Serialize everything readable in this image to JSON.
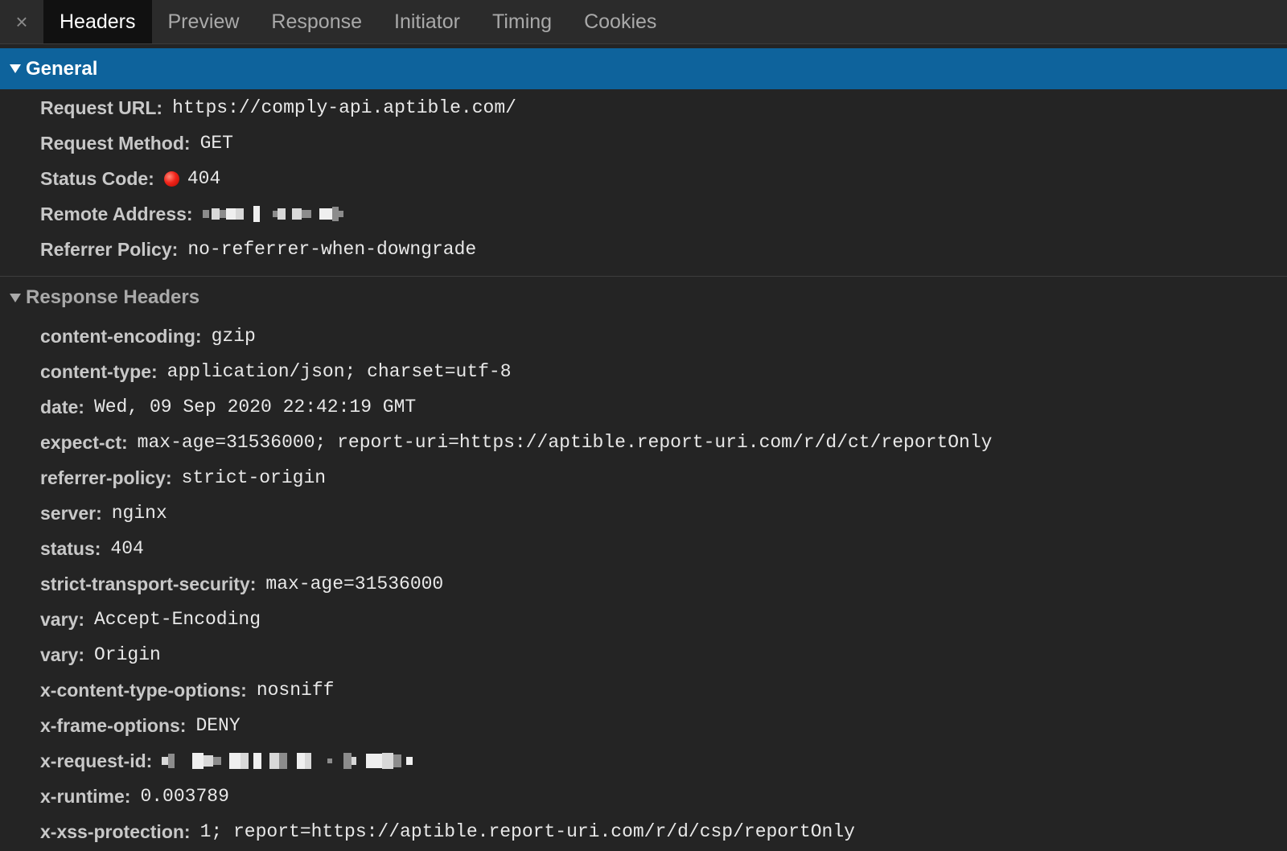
{
  "tabs": {
    "close": "×",
    "items": [
      "Headers",
      "Preview",
      "Response",
      "Initiator",
      "Timing",
      "Cookies"
    ]
  },
  "general": {
    "title": "General",
    "request_url": {
      "key": "Request URL:",
      "value": "https://comply-api.aptible.com/"
    },
    "request_method": {
      "key": "Request Method:",
      "value": "GET"
    },
    "status_code": {
      "key": "Status Code:",
      "value": "404"
    },
    "remote_address": {
      "key": "Remote Address:"
    },
    "referrer_policy": {
      "key": "Referrer Policy:",
      "value": "no-referrer-when-downgrade"
    }
  },
  "response_headers": {
    "title": "Response Headers",
    "items": [
      {
        "key": "content-encoding:",
        "value": "gzip"
      },
      {
        "key": "content-type:",
        "value": "application/json; charset=utf-8"
      },
      {
        "key": "date:",
        "value": "Wed, 09 Sep 2020 22:42:19 GMT"
      },
      {
        "key": "expect-ct:",
        "value": "max-age=31536000; report-uri=https://aptible.report-uri.com/r/d/ct/reportOnly"
      },
      {
        "key": "referrer-policy:",
        "value": "strict-origin"
      },
      {
        "key": "server:",
        "value": "nginx"
      },
      {
        "key": "status:",
        "value": "404"
      },
      {
        "key": "strict-transport-security:",
        "value": "max-age=31536000"
      },
      {
        "key": "vary:",
        "value": "Accept-Encoding"
      },
      {
        "key": "vary:",
        "value": "Origin"
      },
      {
        "key": "x-content-type-options:",
        "value": "nosniff"
      },
      {
        "key": "x-frame-options:",
        "value": "DENY"
      },
      {
        "key": "x-request-id:"
      },
      {
        "key": "x-runtime:",
        "value": "0.003789"
      },
      {
        "key": "x-xss-protection:",
        "value": "1; report=https://aptible.report-uri.com/r/d/csp/reportOnly"
      }
    ]
  }
}
